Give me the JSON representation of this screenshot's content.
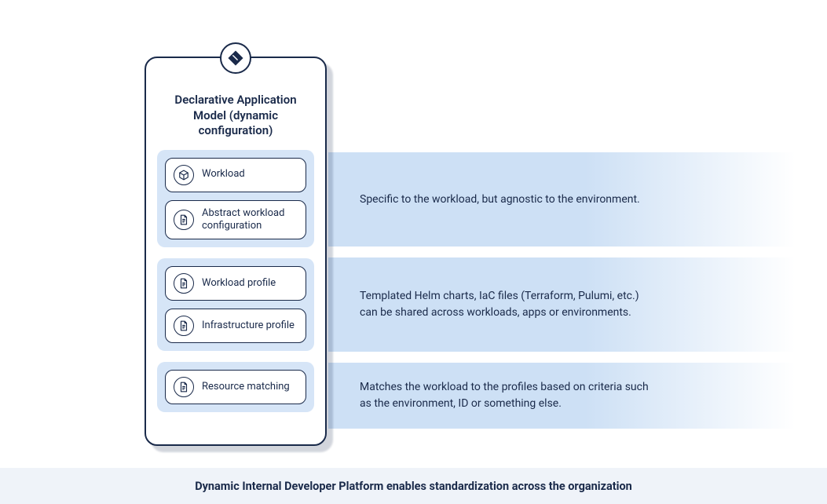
{
  "card": {
    "title": "Declarative Application Model (dynamic configuration)",
    "groups": [
      {
        "items": [
          {
            "icon": "cube",
            "label": "Workload"
          },
          {
            "icon": "doc",
            "label": "Abstract workload configuration"
          }
        ],
        "description": "Specific to the workload, but agnostic to the environment."
      },
      {
        "items": [
          {
            "icon": "doc",
            "label": "Workload profile"
          },
          {
            "icon": "doc",
            "label": "Infrastructure profile"
          }
        ],
        "description": "Templated Helm charts, IaC files (Terraform, Pulumi, etc.) can be shared across workloads, apps or environments."
      },
      {
        "items": [
          {
            "icon": "doc",
            "label": "Resource matching"
          }
        ],
        "description": "Matches the workload to the profiles based on criteria such as the environment, ID or something else."
      }
    ]
  },
  "caption": "Dynamic Internal Developer Platform enables standardization across the organization"
}
